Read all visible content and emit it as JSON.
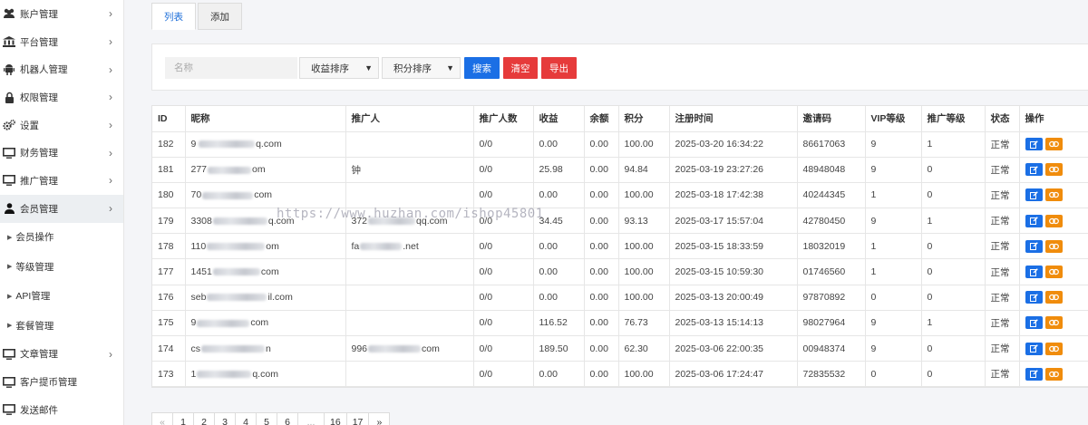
{
  "sidebar": {
    "items": [
      {
        "label": "账户管理",
        "icon": "users-icon",
        "chevron": "›"
      },
      {
        "label": "平台管理",
        "icon": "bank-icon",
        "chevron": "›"
      },
      {
        "label": "机器人管理",
        "icon": "android-icon",
        "chevron": "›"
      },
      {
        "label": "权限管理",
        "icon": "lock-icon",
        "chevron": "›"
      },
      {
        "label": "设置",
        "icon": "gears-icon",
        "chevron": "›"
      },
      {
        "label": "财务管理",
        "icon": "monitor-icon",
        "chevron": "›"
      },
      {
        "label": "推广管理",
        "icon": "monitor-icon",
        "chevron": "›"
      },
      {
        "label": "会员管理",
        "icon": "user-icon",
        "chevron": "›",
        "active": true
      }
    ],
    "sub_items": [
      {
        "label": "会员操作"
      },
      {
        "label": "等级管理"
      },
      {
        "label": "API管理"
      },
      {
        "label": "套餐管理"
      }
    ],
    "items_after": [
      {
        "label": "文章管理",
        "icon": "monitor-icon",
        "chevron": "›"
      },
      {
        "label": "客户提币管理",
        "icon": "monitor-icon",
        "chevron": ""
      },
      {
        "label": "发送邮件",
        "icon": "monitor-icon",
        "chevron": ""
      }
    ]
  },
  "tabs": [
    {
      "label": "列表",
      "active": true
    },
    {
      "label": "添加",
      "active": false
    }
  ],
  "search": {
    "placeholder": "名称",
    "sort_income": "收益排序",
    "sort_points": "积分排序",
    "search_label": "搜索",
    "clear_label": "清空",
    "export_label": "导出"
  },
  "table": {
    "headers": [
      "ID",
      "昵称",
      "推广人",
      "推广人数",
      "收益",
      "余额",
      "积分",
      "注册时间",
      "邀请码",
      "VIP等级",
      "推广等级",
      "状态",
      "操作"
    ],
    "rows": [
      {
        "id": "182",
        "nick_pre": "9 ",
        "nick_post": "q.com",
        "ref_pre": "",
        "ref_post": "",
        "count": "0/0",
        "income": "0.00",
        "balance": "0.00",
        "points": "100.00",
        "time": "2025-03-20 16:34:22",
        "code": "86617063",
        "vip": "9",
        "level": "1",
        "status": "正常"
      },
      {
        "id": "181",
        "nick_pre": "277",
        "nick_post": "om",
        "ref_pre": "钟",
        "ref_post": "",
        "count": "0/0",
        "income": "25.98",
        "balance": "0.00",
        "points": "94.84",
        "time": "2025-03-19 23:27:26",
        "code": "48948048",
        "vip": "9",
        "level": "0",
        "status": "正常"
      },
      {
        "id": "180",
        "nick_pre": "70",
        "nick_post": "com",
        "ref_pre": "",
        "ref_post": "",
        "count": "0/0",
        "income": "0.00",
        "balance": "0.00",
        "points": "100.00",
        "time": "2025-03-18 17:42:38",
        "code": "40244345",
        "vip": "1",
        "level": "0",
        "status": "正常"
      },
      {
        "id": "179",
        "nick_pre": "3308",
        "nick_post": "q.com",
        "ref_pre": "372",
        "ref_post": "qq.com",
        "count": "0/0",
        "income": "34.45",
        "balance": "0.00",
        "points": "93.13",
        "time": "2025-03-17 15:57:04",
        "code": "42780450",
        "vip": "9",
        "level": "1",
        "status": "正常"
      },
      {
        "id": "178",
        "nick_pre": "110",
        "nick_post": "om",
        "ref_pre": "fa",
        "ref_post": ".net",
        "count": "0/0",
        "income": "0.00",
        "balance": "0.00",
        "points": "100.00",
        "time": "2025-03-15 18:33:59",
        "code": "18032019",
        "vip": "1",
        "level": "0",
        "status": "正常"
      },
      {
        "id": "177",
        "nick_pre": "1451",
        "nick_post": "com",
        "ref_pre": "",
        "ref_post": "",
        "count": "0/0",
        "income": "0.00",
        "balance": "0.00",
        "points": "100.00",
        "time": "2025-03-15 10:59:30",
        "code": "01746560",
        "vip": "1",
        "level": "0",
        "status": "正常"
      },
      {
        "id": "176",
        "nick_pre": "seb",
        "nick_post": "il.com",
        "ref_pre": "",
        "ref_post": "",
        "count": "0/0",
        "income": "0.00",
        "balance": "0.00",
        "points": "100.00",
        "time": "2025-03-13 20:00:49",
        "code": "97870892",
        "vip": "0",
        "level": "0",
        "status": "正常"
      },
      {
        "id": "175",
        "nick_pre": "9",
        "nick_post": "com",
        "ref_pre": "",
        "ref_post": "",
        "count": "0/0",
        "income": "116.52",
        "balance": "0.00",
        "points": "76.73",
        "time": "2025-03-13 15:14:13",
        "code": "98027964",
        "vip": "9",
        "level": "1",
        "status": "正常"
      },
      {
        "id": "174",
        "nick_pre": "cs",
        "nick_post": "n",
        "ref_pre": "996",
        "ref_post": "com",
        "count": "0/0",
        "income": "189.50",
        "balance": "0.00",
        "points": "62.30",
        "time": "2025-03-06 22:00:35",
        "code": "00948374",
        "vip": "9",
        "level": "0",
        "status": "正常"
      },
      {
        "id": "173",
        "nick_pre": "1",
        "nick_post": "q.com",
        "ref_pre": "",
        "ref_post": "",
        "count": "0/0",
        "income": "0.00",
        "balance": "0.00",
        "points": "100.00",
        "time": "2025-03-06 17:24:47",
        "code": "72835532",
        "vip": "0",
        "level": "0",
        "status": "正常"
      }
    ]
  },
  "watermark": "https://www.huzhan.com/ishop45801",
  "pagination": {
    "prev": "«",
    "pages": [
      "1",
      "2",
      "3",
      "4",
      "5",
      "6",
      "...",
      "16",
      "17"
    ],
    "next": "»"
  },
  "colors": {
    "primary": "#1b6fe5",
    "danger": "#e63b3b",
    "warning": "#f08c0c",
    "active_tab_text": "#1e6fd9"
  }
}
